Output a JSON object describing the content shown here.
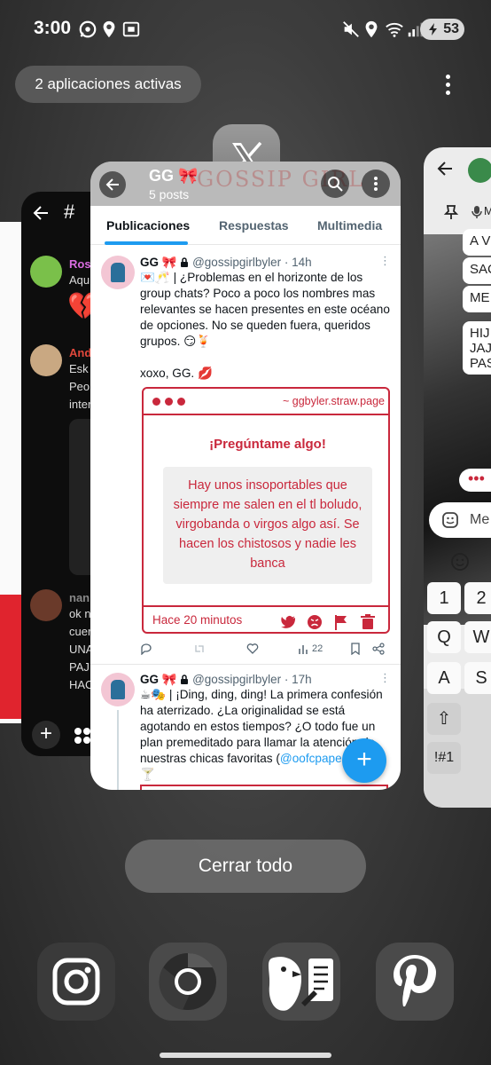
{
  "status_bar": {
    "time": "3:00",
    "battery": "53"
  },
  "overview": {
    "active_apps_label": "2 aplicaciones activas",
    "close_all_label": "Cerrar todo"
  },
  "left_card": {
    "header_symbol": "#",
    "messages": [
      {
        "name": "Rosa",
        "name_color": "#d96de0",
        "text": "Aqu",
        "avatar_color": "#7ac04a"
      },
      {
        "name": "And",
        "name_color": "#e0483c",
        "text": "Esk\nPeo\ninter",
        "avatar_color": "#c9a882"
      },
      {
        "name": "nan",
        "name_color": "#888888",
        "text": "ok n\ncuer\nUNA\nPAJ\nHAC",
        "avatar_color": "#6a3a2a"
      }
    ],
    "emoji": "💔"
  },
  "right_card": {
    "bubbles": [
      "A V",
      "SAC",
      "ME",
      "HIJ\nJAJ\nPAS"
    ],
    "compose_placeholder": "Me",
    "keys_row1": [
      "1",
      "2"
    ],
    "keys_row2": [
      "Q",
      "W"
    ],
    "keys_row3": [
      "A",
      "S"
    ],
    "symbols_key": "!#1",
    "input_label": "M"
  },
  "main_card": {
    "profile_title": "GG 🎀",
    "posts_count": "5 posts",
    "banner_text": "GOSSIP GIRL",
    "tabs": [
      "Publicaciones",
      "Respuestas",
      "Multimedia"
    ],
    "tweets": [
      {
        "name": "GG 🎀",
        "handle": "@gossipgirlbyler",
        "time": "14h",
        "body": "💌🥂 | ¿Problemas en el horizonte de los group chats? Poco a poco los nombres mas relevantes se hacen presentes en este océano de opciones. No se queden fuera, queridos grupos. 😏🍹\n\nxoxo, GG. 💋",
        "embed": {
          "url": "~ ggbyler.straw.page",
          "title": "¡Pregúntame algo!",
          "message": "Hay unos insoportables que siempre me salen en el tl boludo, virgobanda o virgos algo así. Se hacen los chistosos y nadie les banca",
          "time": "Hace 20 minutos"
        },
        "views": "22"
      },
      {
        "name": "GG 🎀",
        "handle": "@gossipgirlbyler",
        "time": "17h",
        "body_prefix": "☕🎭 | ¡Ding, ding, ding! La primera confesión ha aterrizado. ¿La originalidad se está agotando en estos tiempos? ¿O todo fue un plan premeditado para llamar la atención de nuestras chicas favoritas (",
        "mention": "@oofcpaper",
        "body_suffix": "🍸"
      }
    ]
  },
  "dock": [
    "instagram-icon",
    "chrome-icon",
    "bird-app-icon",
    "pinterest-icon"
  ],
  "colors": {
    "accent": "#1d9bf0",
    "embed_red": "#c9283c"
  }
}
